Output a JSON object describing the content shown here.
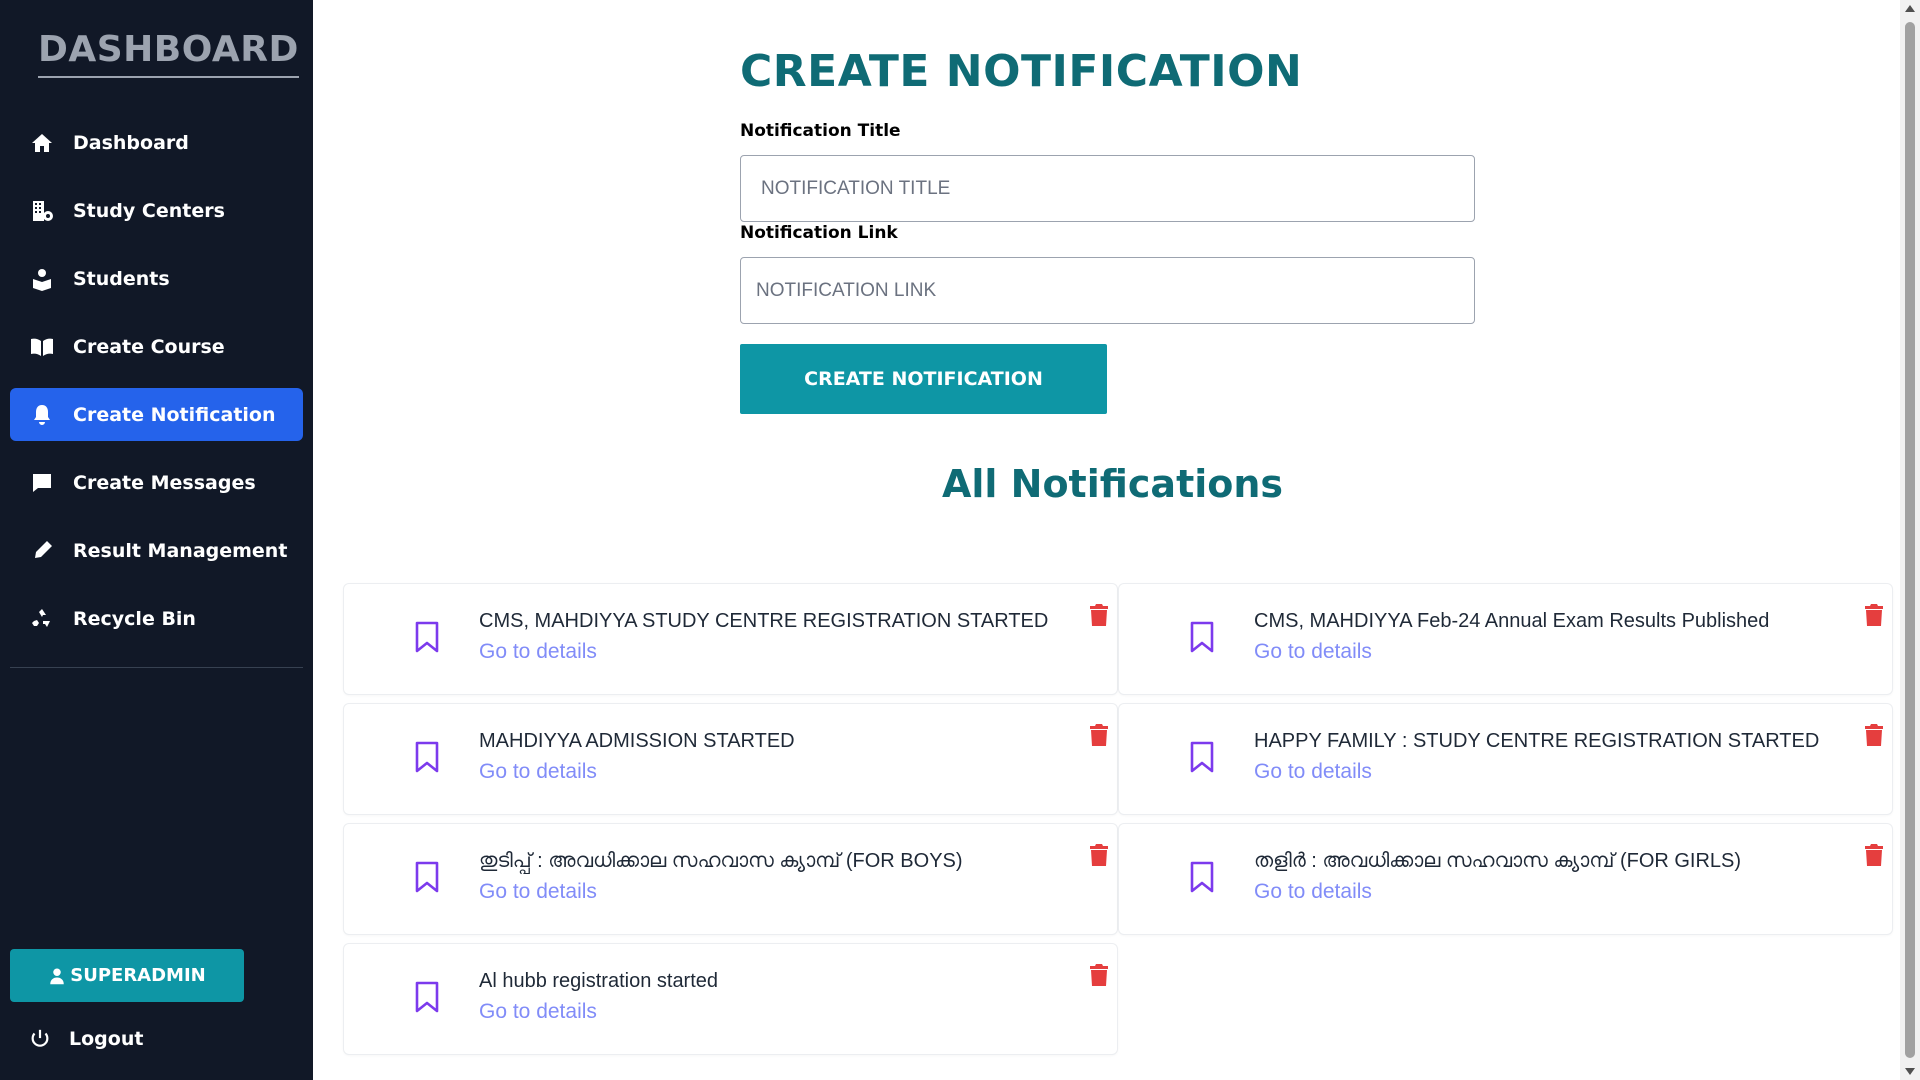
{
  "sidebar": {
    "brand": "DASHBOARD",
    "items": [
      {
        "label": "Dashboard",
        "icon": "home-icon"
      },
      {
        "label": "Study Centers",
        "icon": "building-icon"
      },
      {
        "label": "Students",
        "icon": "students-icon"
      },
      {
        "label": "Create Course",
        "icon": "book-icon"
      },
      {
        "label": "Create Notification",
        "icon": "bell-icon",
        "active": true
      },
      {
        "label": "Create Messages",
        "icon": "message-icon"
      },
      {
        "label": "Result Management",
        "icon": "pen-icon"
      },
      {
        "label": "Recycle Bin",
        "icon": "recycle-icon"
      }
    ],
    "admin_label": "SUPERADMIN",
    "logout_label": "Logout"
  },
  "form": {
    "title": "CREATE NOTIFICATION",
    "title_label": "Notification Title",
    "title_placeholder": "NOTIFICATION TITLE",
    "link_label": "Notification Link",
    "link_placeholder": "NOTIFICATION LINK",
    "submit_label": "CREATE NOTIFICATION"
  },
  "notifications": {
    "heading": "All Notifications",
    "link_text": "Go to details",
    "items": [
      {
        "title": "CMS, MAHDIYYA STUDY CENTRE REGISTRATION STARTED"
      },
      {
        "title": "CMS, MAHDIYYA Feb-24 Annual Exam Results Published"
      },
      {
        "title": "MAHDIYYA ADMISSION STARTED"
      },
      {
        "title": "HAPPY FAMILY : STUDY CENTRE REGISTRATION STARTED"
      },
      {
        "title": "തുടിപ്പ് : അവധിക്കാല സഹവാസ ക്യാമ്പ് (FOR BOYS)"
      },
      {
        "title": "തളിർ : അവധിക്കാല സഹവാസ ക്യാമ്പ് (FOR GIRLS)"
      },
      {
        "title": "Al hubb registration started"
      }
    ]
  },
  "colors": {
    "sidebar_bg": "#111827",
    "active_nav": "#2563eb",
    "accent": "#0e96a5",
    "heading": "#0f6b75",
    "link": "#818cf8",
    "bookmark": "#7c3aed",
    "delete": "#e53e3e"
  }
}
